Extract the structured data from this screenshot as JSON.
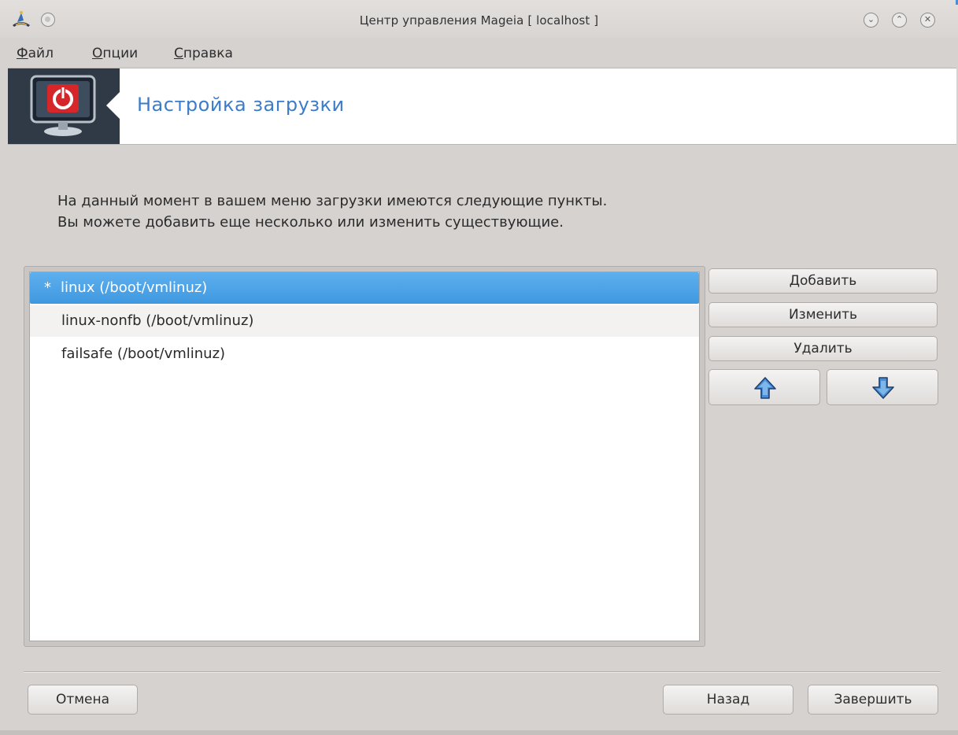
{
  "window": {
    "title": "Центр управления Mageia  [ localhost ]",
    "icons": {
      "app": "mageia-hat-icon",
      "sticky": "pin-icon",
      "minimize": "chevron-down-icon",
      "maximize": "chevron-up-icon",
      "close": "close-icon"
    },
    "minimize_glyph": "⌄",
    "maximize_glyph": "⌃",
    "close_glyph": "✕"
  },
  "menubar": {
    "file": {
      "accel": "Ф",
      "rest": "айл"
    },
    "options": {
      "accel": "О",
      "rest": "пции"
    },
    "help": {
      "accel": "С",
      "rest": "правка"
    }
  },
  "header": {
    "title": "Настройка загрузки",
    "icon": "boot-power-monitor-icon"
  },
  "description": {
    "line1": "На данный момент в вашем меню загрузки имеются следующие пункты.",
    "line2": "Вы можете добавить еще несколько или изменить существующие."
  },
  "entries": [
    {
      "star": "*",
      "label": "linux (/boot/vmlinuz)",
      "selected": true
    },
    {
      "star": "",
      "label": "linux-nonfb (/boot/vmlinuz)",
      "selected": false
    },
    {
      "star": "",
      "label": "failsafe (/boot/vmlinuz)",
      "selected": false
    }
  ],
  "side_buttons": {
    "add": "Добавить",
    "edit": "Изменить",
    "delete": "Удалить",
    "up_icon": "arrow-up-icon",
    "down_icon": "arrow-down-icon"
  },
  "footer": {
    "cancel": "Отмена",
    "back": "Назад",
    "finish": "Завершить"
  },
  "colors": {
    "accent_blue": "#3d7cc8",
    "selection": "#3f98e0",
    "background": "#d6d2d0",
    "banner_dark": "#2f3a46"
  }
}
